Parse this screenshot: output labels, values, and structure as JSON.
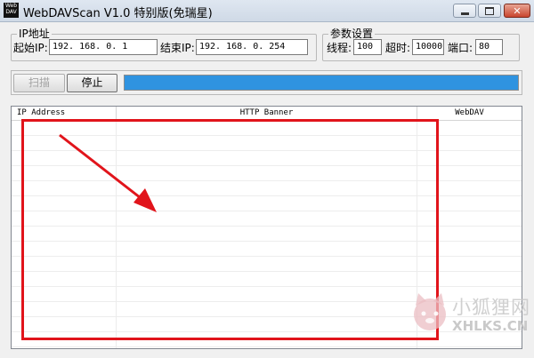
{
  "window": {
    "title": "WebDAVScan V1.0 特别版(免瑞星)",
    "icon_text": "WebDAV",
    "controls": {
      "minimize": "minimize-icon",
      "maximize": "maximize-icon",
      "close": "close-icon"
    }
  },
  "ip_group": {
    "title": "IP地址",
    "start_label": "起始IP:",
    "start_value": "192. 168. 0. 1",
    "end_label": "结束IP:",
    "end_value": "192. 168. 0. 254"
  },
  "param_group": {
    "title": "参数设置",
    "threads_label": "线程:",
    "threads_value": "100",
    "timeout_label": "超时:",
    "timeout_value": "10000",
    "port_label": "端口:",
    "port_value": "80"
  },
  "controls": {
    "scan_label": "扫描",
    "stop_label": "停止",
    "progress": 1.0,
    "progress_color": "#2f93e0"
  },
  "results": {
    "columns": [
      "IP Address",
      "HTTP Banner",
      "WebDAV"
    ],
    "rows": []
  },
  "annotation": {
    "color": "#e1141b"
  },
  "watermark": {
    "cn": "小狐狸网",
    "en": "XHLKS.CN",
    "icon": "fox-logo-icon"
  }
}
